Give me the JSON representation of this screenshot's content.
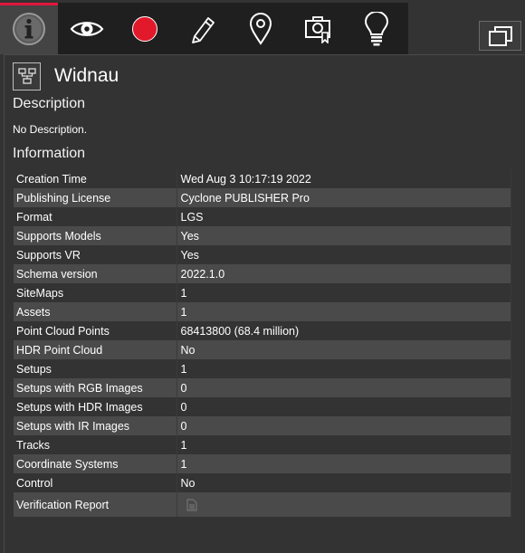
{
  "toolbar": {
    "tabs": [
      {
        "name": "info",
        "icon": "info-icon",
        "active": true
      },
      {
        "name": "view",
        "icon": "eye-icon",
        "active": false
      },
      {
        "name": "record",
        "icon": "record-icon",
        "active": false
      },
      {
        "name": "edit",
        "icon": "pencil-icon",
        "active": false
      },
      {
        "name": "location",
        "icon": "map-pin-icon",
        "active": false
      },
      {
        "name": "snapshot",
        "icon": "camera-badge-icon",
        "active": false
      },
      {
        "name": "ideas",
        "icon": "lightbulb-icon",
        "active": false
      }
    ],
    "accent_color": "#e2173b",
    "record_color": "#e1192b"
  },
  "site": {
    "title": "Widnau",
    "icon": "sitemap-icon"
  },
  "description": {
    "heading": "Description",
    "text": "No Description."
  },
  "information": {
    "heading": "Information",
    "rows": [
      {
        "label": "Creation Time",
        "value": "Wed Aug 3 10:17:19 2022"
      },
      {
        "label": "Publishing License",
        "value": "Cyclone PUBLISHER Pro"
      },
      {
        "label": "Format",
        "value": "LGS"
      },
      {
        "label": "Supports Models",
        "value": "Yes"
      },
      {
        "label": "Supports VR",
        "value": "Yes"
      },
      {
        "label": "Schema version",
        "value": "2022.1.0"
      },
      {
        "label": "SiteMaps",
        "value": "1"
      },
      {
        "label": "Assets",
        "value": "1"
      },
      {
        "label": "Point Cloud Points",
        "value": "68413800 (68.4 million)"
      },
      {
        "label": "HDR Point Cloud",
        "value": "No"
      },
      {
        "label": "Setups",
        "value": "1"
      },
      {
        "label": "Setups with RGB Images",
        "value": "0"
      },
      {
        "label": "Setups with HDR Images",
        "value": "0"
      },
      {
        "label": "Setups with IR Images",
        "value": "0"
      },
      {
        "label": "Tracks",
        "value": "1"
      },
      {
        "label": "Coordinate Systems",
        "value": "1"
      },
      {
        "label": "Control",
        "value": "No"
      }
    ],
    "verification": {
      "label": "Verification Report",
      "icon": "document-icon"
    }
  }
}
